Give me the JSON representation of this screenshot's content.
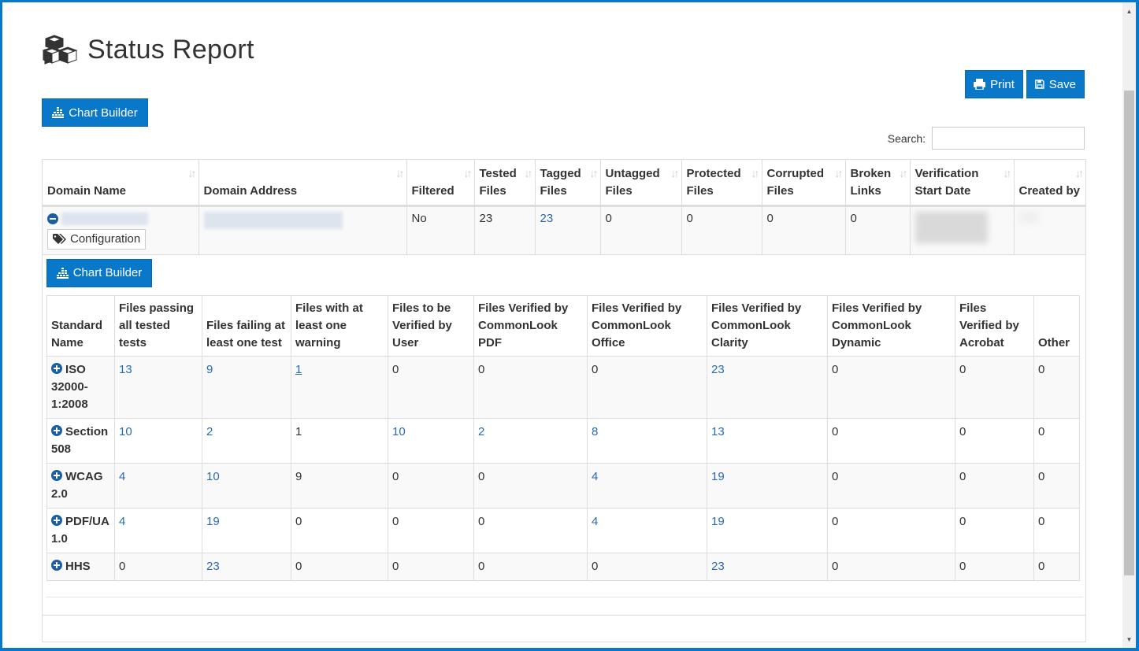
{
  "page": {
    "title": "Status Report",
    "title_icon": "cubes-icon"
  },
  "toolbar": {
    "print_label": "Print",
    "save_label": "Save",
    "chart_builder_label": "Chart Builder"
  },
  "search": {
    "label": "Search:",
    "value": "",
    "placeholder": ""
  },
  "main_table": {
    "columns": [
      "Domain Name",
      "Domain Address",
      "Filtered",
      "Tested Files",
      "Tagged Files",
      "Untagged Files",
      "Protected Files",
      "Corrupted Files",
      "Broken Links",
      "Verification Start Date",
      "Created by"
    ],
    "rows": [
      {
        "domain_name": "[redacted]",
        "config_label": "Configuration",
        "domain_address": "[redacted]",
        "filtered": "No",
        "tested_files": "23",
        "tagged_files": "23",
        "untagged_files": "0",
        "protected_files": "0",
        "corrupted_files": "0",
        "broken_links": "0",
        "verification_start_date": "[redacted]",
        "created_by": "[redacted]"
      }
    ]
  },
  "detail": {
    "chart_builder_label": "Chart Builder",
    "columns": [
      "Standard Name",
      "Files passing all tested tests",
      "Files failing at least one test",
      "Files with at least one warning",
      "Files to be Verified by User",
      "Files Verified by CommonLook PDF",
      "Files Verified by CommonLook Office",
      "Files Verified by CommonLook Clarity",
      "Files Verified by CommonLook Dynamic",
      "Files Verified by Acrobat",
      "Other"
    ],
    "rows": [
      {
        "name": "ISO 32000-1:2008",
        "values": [
          "13",
          "9",
          "1",
          "0",
          "0",
          "0",
          "23",
          "0",
          "0",
          "0"
        ]
      },
      {
        "name": "Section 508",
        "values": [
          "10",
          "2",
          "1",
          "10",
          "2",
          "8",
          "13",
          "0",
          "0",
          "0"
        ]
      },
      {
        "name": "WCAG 2.0",
        "values": [
          "4",
          "10",
          "9",
          "0",
          "0",
          "4",
          "19",
          "0",
          "0",
          "0"
        ]
      },
      {
        "name": "PDF/UA 1.0",
        "values": [
          "4",
          "19",
          "0",
          "0",
          "0",
          "4",
          "19",
          "0",
          "0",
          "0"
        ]
      },
      {
        "name": "HHS",
        "values": [
          "0",
          "23",
          "0",
          "0",
          "0",
          "0",
          "23",
          "0",
          "0",
          "0"
        ]
      }
    ]
  },
  "colors": {
    "accent": "#0a78c8",
    "link": "#2a6bb0",
    "standard_name": "#1a5ea8"
  }
}
